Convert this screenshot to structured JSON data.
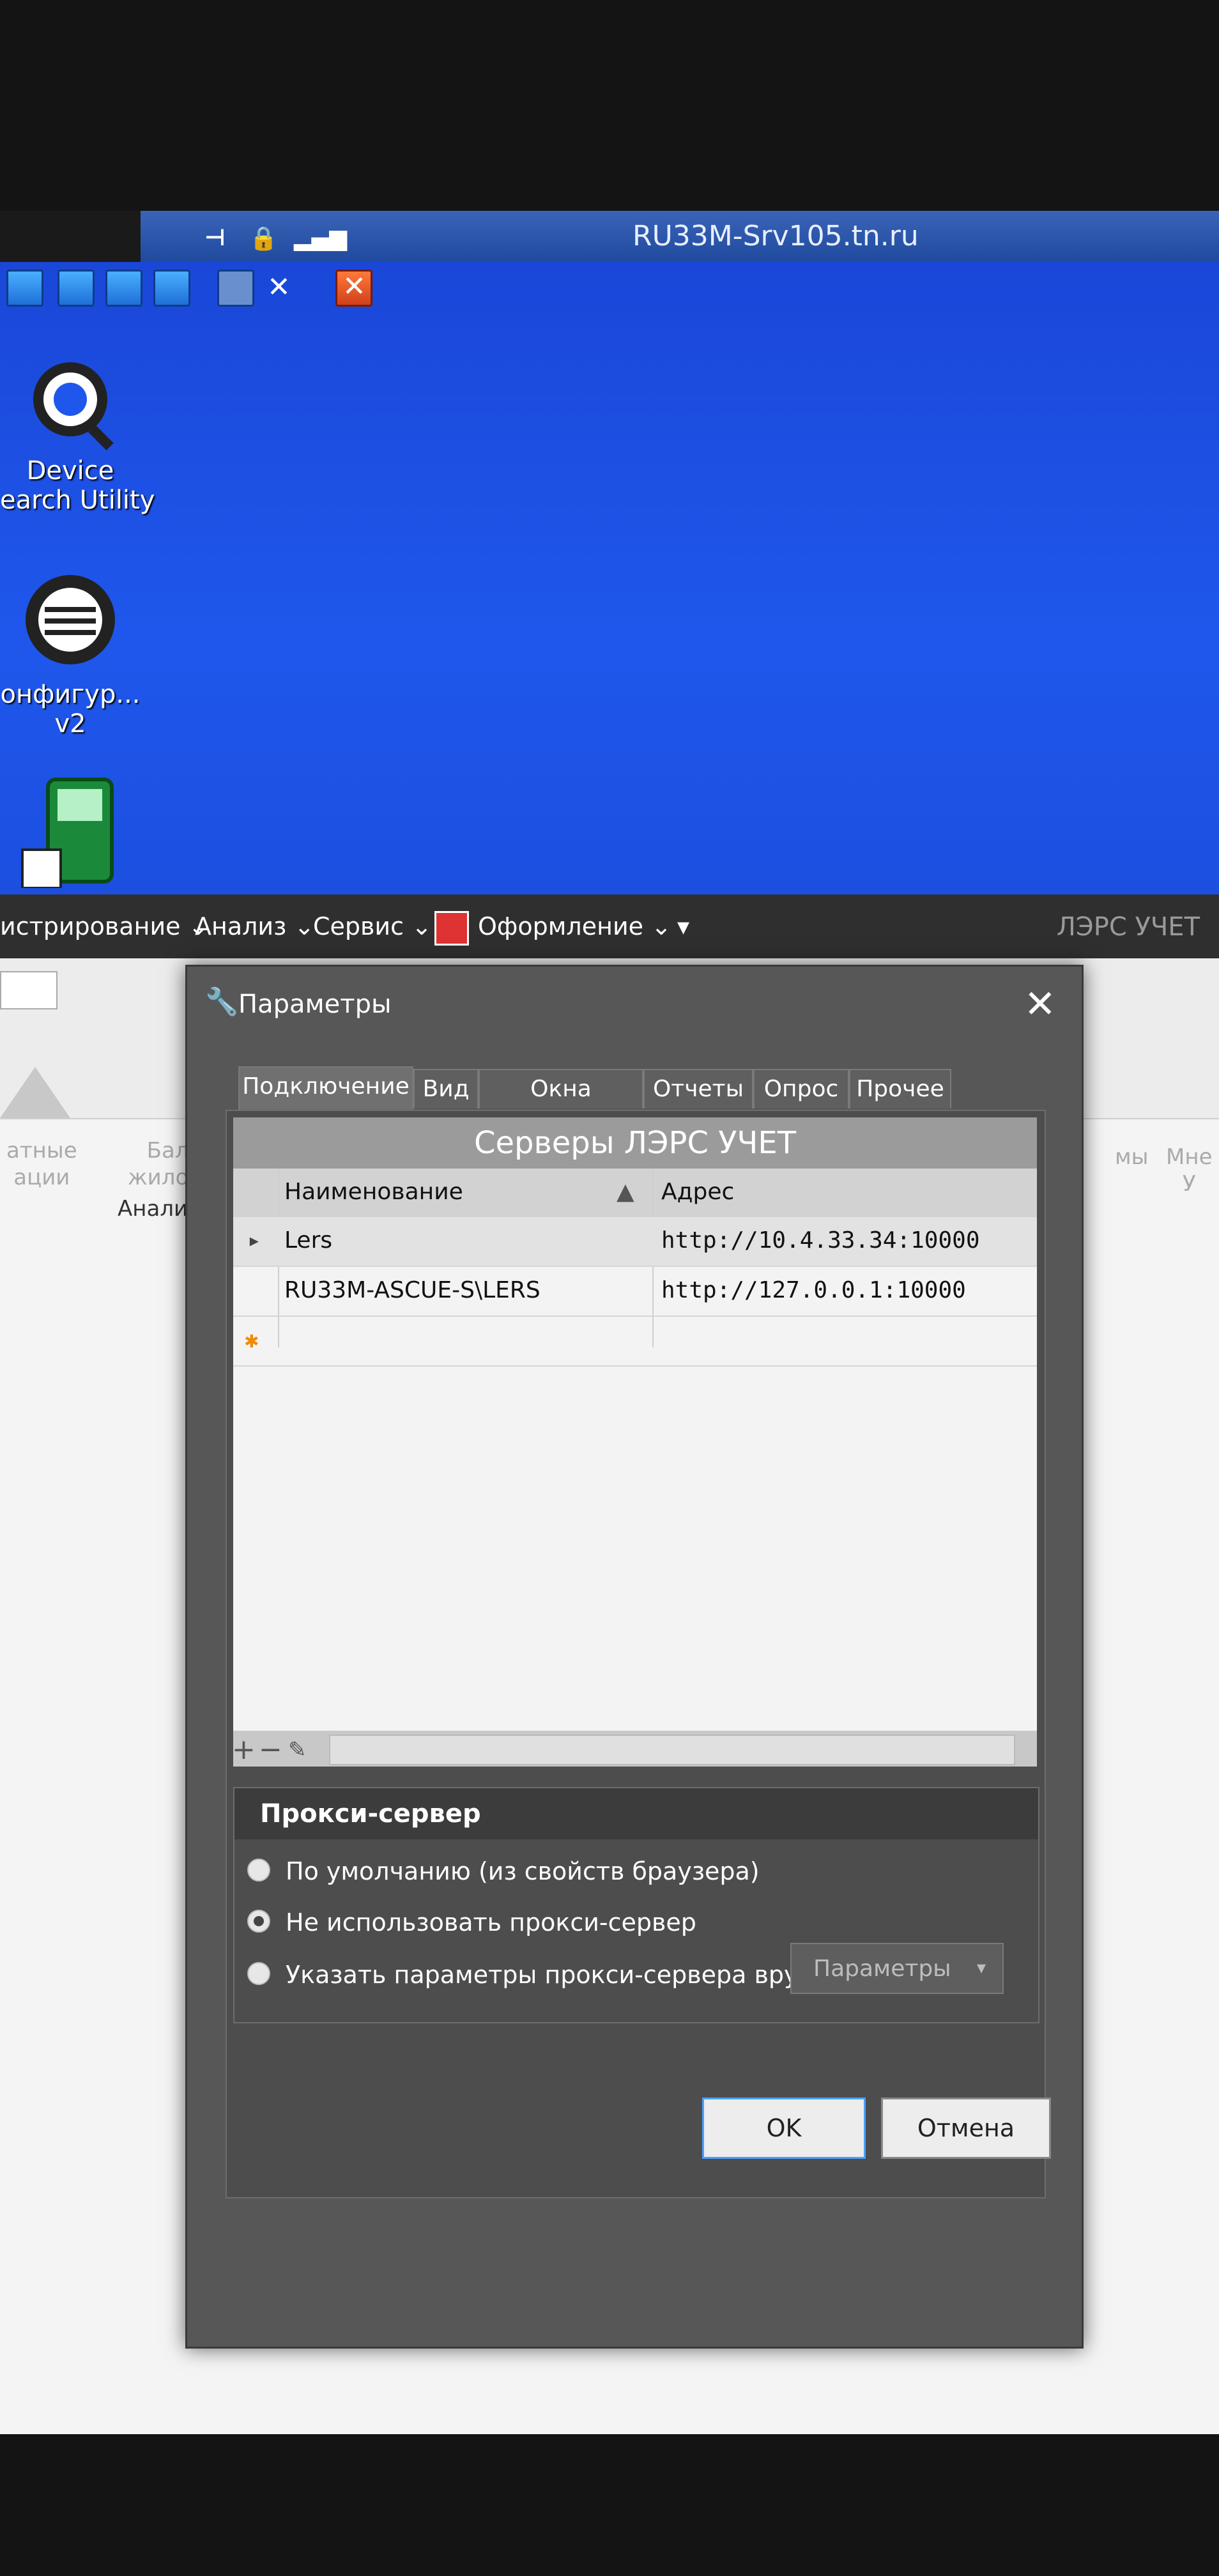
{
  "rdp": {
    "title": "RU33M-Srv105.tn.ru"
  },
  "desktop": {
    "icons": [
      {
        "label": "Device\nearch Utility",
        "icon": "search-gear-icon"
      },
      {
        "label": "онфигур...\nv2",
        "icon": "gear-icon"
      },
      {
        "label": "",
        "icon": "app-icon"
      }
    ]
  },
  "app": {
    "menu": [
      "истрирование ⌄",
      "Анализ ⌄",
      "Сервис ⌄",
      "Оформление ⌄"
    ],
    "brand": "ЛЭРС УЧЕТ",
    "ribbon": {
      "item1": "атные\nации",
      "item2": "Балан\nжилого д",
      "group": "Анализ",
      "right1": "мы",
      "right2": "Мне\nУ"
    }
  },
  "dialog": {
    "title": "Параметры",
    "tabs": [
      "Подключение",
      "Вид",
      "Окна свойств",
      "Отчеты",
      "Опрос",
      "Прочее"
    ],
    "active_tab": 0,
    "grid": {
      "caption": "Серверы ЛЭРС УЧЕТ",
      "columns": [
        "Наименование",
        "Адрес"
      ],
      "rows": [
        {
          "name": "Lers",
          "address": "http://10.4.33.34:10000"
        },
        {
          "name": "RU33M-ASCUE-S\\LERS",
          "address": "http://127.0.0.1:10000"
        }
      ]
    },
    "proxy": {
      "title": "Прокси-сервер",
      "options": [
        "По умолчанию (из свойств браузера)",
        "Не использовать прокси-сервер",
        "Указать параметры прокси-сервера вручную"
      ],
      "selected": 1,
      "params_button": "Параметры"
    },
    "ok": "OK",
    "cancel": "Отмена"
  }
}
